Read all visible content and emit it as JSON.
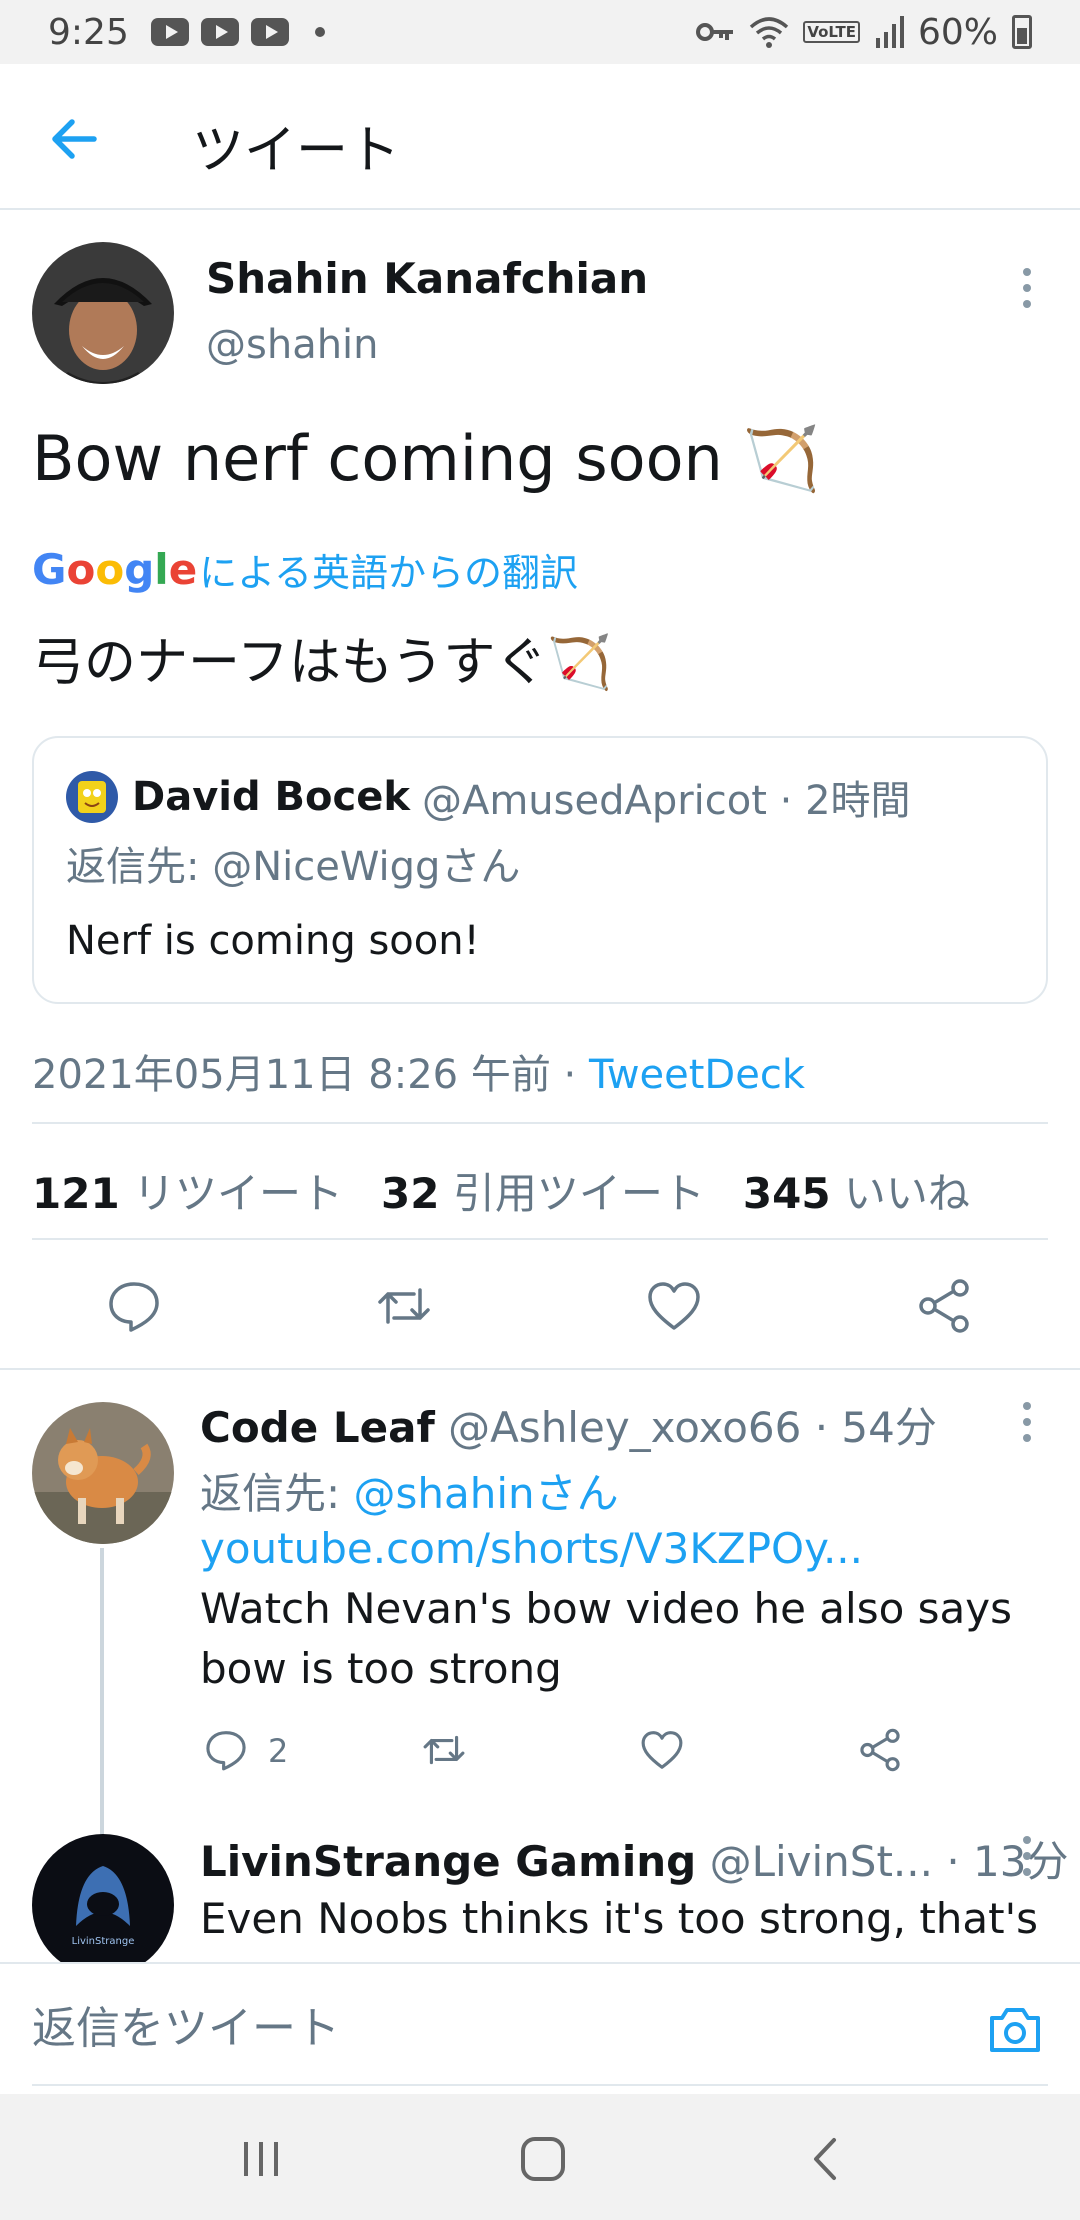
{
  "status_bar": {
    "time": "9:25",
    "battery": "60%",
    "volte": "VoLTE"
  },
  "header": {
    "title": "ツイート"
  },
  "tweet": {
    "author_name": "Shahin Kanafchian",
    "author_handle": "@shahin",
    "text": "Bow nerf coming soon 🏹",
    "translation_label": "による英語からの翻訳",
    "google_brand": [
      "G",
      "o",
      "o",
      "g",
      "l",
      "e"
    ],
    "translated_text": "弓のナーフはもうすぐ🏹",
    "quoted": {
      "name": "David Bocek",
      "handle": "@AmusedApricot · 2時間",
      "reply_to": "返信先: @NiceWiggさん",
      "text": "Nerf is coming soon!"
    },
    "timestamp": "2021年05月11日 8:26 午前 · ",
    "client": "TweetDeck",
    "stats": {
      "retweets_count": "121",
      "retweets_label": "リツイート",
      "quotes_count": "32",
      "quotes_label": "引用ツイート",
      "likes_count": "345",
      "likes_label": "いいね"
    }
  },
  "replies": [
    {
      "name": "Code Leaf",
      "meta": "@Ashley_xoxo66 · 54分",
      "reply_to_prefix": "返信先: ",
      "reply_to_handle": "@shahinさん",
      "link": "youtube.com/shorts/V3KZPOy...",
      "text_line1": "Watch Nevan's bow video he also says",
      "text_line2": "bow is too strong",
      "reply_count": "2"
    },
    {
      "name": "LivinStrange Gaming",
      "meta": "@LivinSt... · 13分",
      "text_line1": "Even Noobs thinks it's too strong, that's",
      "avatar_text": "LivinStrange"
    }
  ],
  "compose": {
    "placeholder": "返信をツイート"
  },
  "colors": {
    "accent": "#1da1f2",
    "secondary_text": "#657786",
    "divider": "#e1e8ed"
  }
}
